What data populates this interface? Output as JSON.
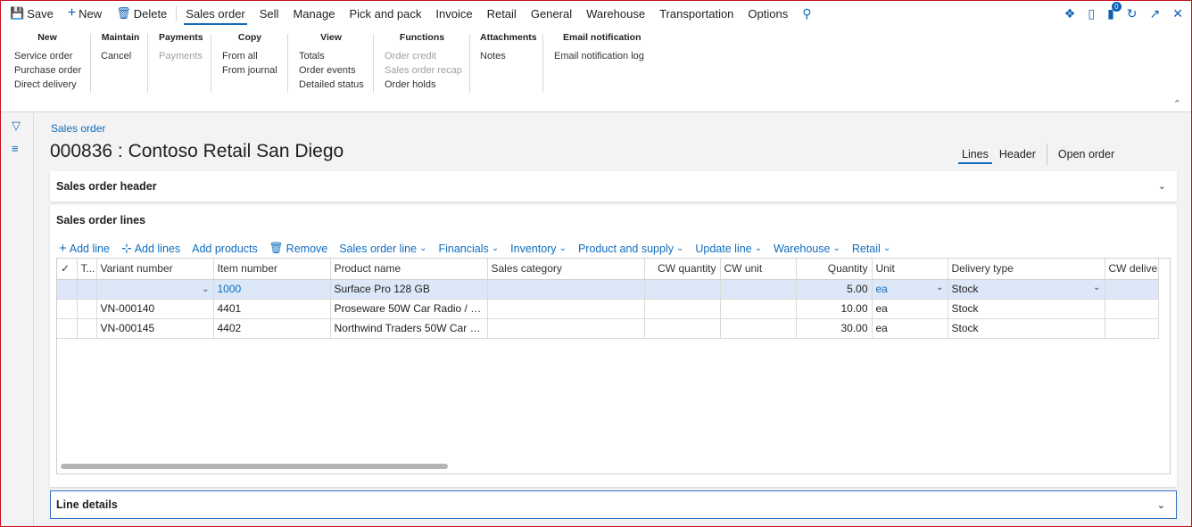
{
  "actionbar": {
    "save": "Save",
    "new": "New",
    "delete": "Delete",
    "tabs": [
      "Sales order",
      "Sell",
      "Manage",
      "Pick and pack",
      "Invoice",
      "Retail",
      "General",
      "Warehouse",
      "Transportation",
      "Options"
    ],
    "notification_count": "0"
  },
  "ribbon": {
    "groups": [
      {
        "title": "New",
        "items": [
          {
            "label": "Service order",
            "disabled": false
          },
          {
            "label": "Purchase order",
            "disabled": false
          },
          {
            "label": "Direct delivery",
            "disabled": false
          }
        ]
      },
      {
        "title": "Maintain",
        "items": [
          {
            "label": "Cancel",
            "disabled": false
          }
        ]
      },
      {
        "title": "Payments",
        "items": [
          {
            "label": "Payments",
            "disabled": true
          }
        ]
      },
      {
        "title": "Copy",
        "items": [
          {
            "label": "From all",
            "disabled": false
          },
          {
            "label": "From journal",
            "disabled": false
          }
        ]
      },
      {
        "title": "View",
        "items": [
          {
            "label": "Totals",
            "disabled": false
          },
          {
            "label": "Order events",
            "disabled": false
          },
          {
            "label": "Detailed status",
            "disabled": false
          }
        ]
      },
      {
        "title": "Functions",
        "items": [
          {
            "label": "Order credit",
            "disabled": true
          },
          {
            "label": "Sales order recap",
            "disabled": true
          },
          {
            "label": "Order holds",
            "disabled": false
          }
        ]
      },
      {
        "title": "Attachments",
        "items": [
          {
            "label": "Notes",
            "disabled": false
          }
        ]
      },
      {
        "title": "Email notification",
        "items": [
          {
            "label": "Email notification log",
            "disabled": false
          }
        ]
      }
    ]
  },
  "page": {
    "breadcrumb": "Sales order",
    "title": "000836 : Contoso Retail San Diego",
    "view_tabs": {
      "lines": "Lines",
      "header": "Header",
      "open_order": "Open order"
    }
  },
  "sections": {
    "header": "Sales order header",
    "lines": "Sales order lines",
    "line_details": "Line details"
  },
  "grid_toolbar": {
    "add_line": "Add line",
    "add_lines": "Add lines",
    "add_products": "Add products",
    "remove": "Remove",
    "menus": [
      "Sales order line",
      "Financials",
      "Inventory",
      "Product and supply",
      "Update line",
      "Warehouse",
      "Retail"
    ]
  },
  "grid": {
    "columns": [
      "T...",
      "Variant number",
      "Item number",
      "Product name",
      "Sales category",
      "CW quantity",
      "CW unit",
      "Quantity",
      "Unit",
      "Delivery type",
      "CW deliver"
    ],
    "rows": [
      {
        "variant": "",
        "item": "1000",
        "product": "Surface Pro 128 GB",
        "category": "",
        "cw_qty": "",
        "cw_unit": "",
        "qty": "5.00",
        "unit": "ea",
        "delivery": "Stock",
        "cw_deliver": ""
      },
      {
        "variant": "VN-000140",
        "item": "4401",
        "product": "Proseware 50W Car Radio / P...",
        "category": "",
        "cw_qty": "",
        "cw_unit": "",
        "qty": "10.00",
        "unit": "ea",
        "delivery": "Stock",
        "cw_deliver": ""
      },
      {
        "variant": "VN-000145",
        "item": "4402",
        "product": "Northwind Traders 50W Car R...",
        "category": "",
        "cw_qty": "",
        "cw_unit": "",
        "qty": "30.00",
        "unit": "ea",
        "delivery": "Stock",
        "cw_deliver": ""
      }
    ]
  }
}
